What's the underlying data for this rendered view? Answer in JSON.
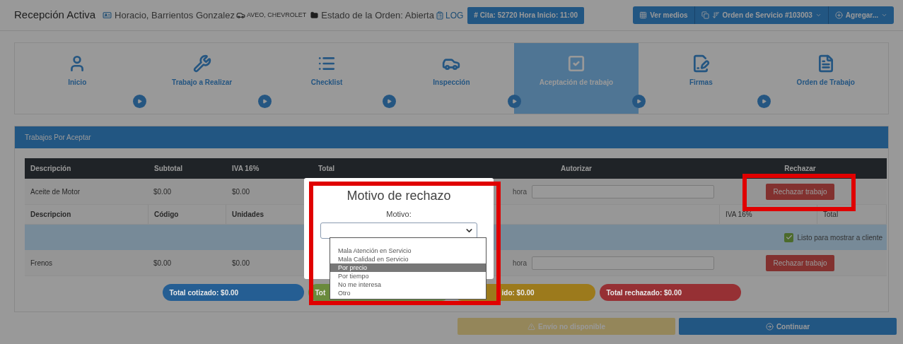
{
  "header": {
    "title": "Recepción Activa",
    "customer": "Horacio, Barrientos Gonzalez",
    "vehicle": "AVEO, CHEVROLET",
    "order_status": "Estado de la Orden: Abierta",
    "log_link": "LOG",
    "appointment_badge": "# Cita: 52720 Hora Inicio: 11:00"
  },
  "actions": [
    {
      "label": "Ver medios",
      "caret": false
    },
    {
      "label": "Orden de Servicio #103003",
      "caret": true
    },
    {
      "label": "Agregar...",
      "caret": true
    }
  ],
  "steps": [
    {
      "label": "Inicio",
      "selected": false
    },
    {
      "label": "Trabajo a Realizar",
      "selected": false
    },
    {
      "label": "Checklist",
      "selected": false
    },
    {
      "label": "Inspección",
      "selected": false
    },
    {
      "label": "Aceptación de trabajo",
      "selected": true
    },
    {
      "label": "Firmas",
      "selected": false
    },
    {
      "label": "Orden de Trabajo",
      "selected": false
    }
  ],
  "panel": {
    "title": "Trabajos Por Aceptar"
  },
  "table": {
    "columns": [
      "Descripción",
      "Subtotal",
      "IVA 16%",
      "Total",
      "Autorizar",
      "Rechazar"
    ],
    "rows": [
      {
        "kind": "job",
        "description": "Aceite de Motor",
        "subtotal": "$0.00",
        "iva": "$0.00",
        "authorize_label": "hora",
        "reject_button": "Rechazar trabajo"
      },
      {
        "kind": "subheader",
        "cells": [
          "Descripcion",
          "Código",
          "Unidades",
          "IVA 16%",
          "Total"
        ]
      },
      {
        "kind": "ready",
        "label": "Listo para mostrar a cliente",
        "checked": true
      },
      {
        "kind": "job",
        "description": "Frenos",
        "subtotal": "$0.00",
        "iva": "$0.00",
        "authorize_label": "hora",
        "reject_button": "Rechazar trabajo"
      }
    ]
  },
  "totals": [
    {
      "text": "Total cotizado: $0.00",
      "color": "#255e93"
    },
    {
      "text": "Tot",
      "color": "#6a8a3c"
    },
    {
      "text": "ido: $0.00",
      "color": "#9c7a1c"
    },
    {
      "text": "Total rechazado: $0.00",
      "color": "#963034"
    }
  ],
  "footer_buttons": [
    {
      "label": "Envío no disponible",
      "kind": "warning",
      "disabled": true
    },
    {
      "label": "Continuar",
      "kind": "primary",
      "disabled": false
    }
  ],
  "modal": {
    "title": "Motivo de rechazo",
    "field_label": "Motivo:",
    "options": [
      {
        "label": "Mala Atención en Servicio",
        "selected": false
      },
      {
        "label": "Mala Calidad en Servicio",
        "selected": false
      },
      {
        "label": "Por precio",
        "selected": true
      },
      {
        "label": "Por tiempo",
        "selected": false
      },
      {
        "label": "No me interesa",
        "selected": false
      },
      {
        "label": "Otro",
        "selected": false
      }
    ]
  }
}
